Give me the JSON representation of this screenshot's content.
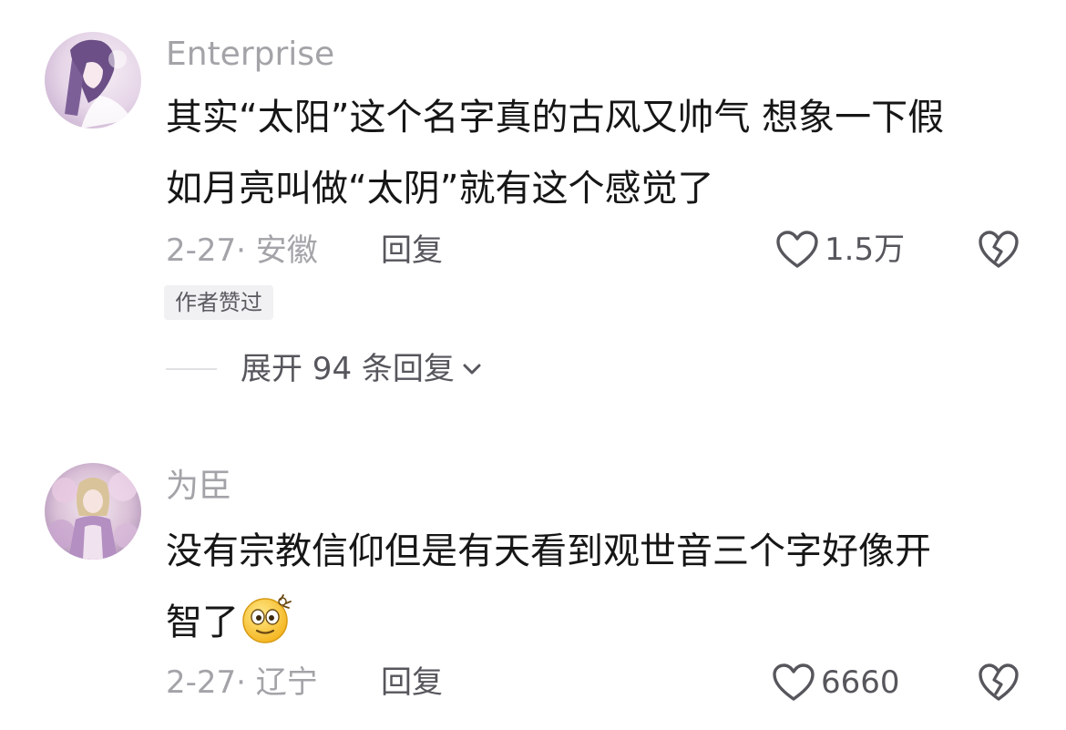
{
  "comments": [
    {
      "username": "Enterprise",
      "text": "其实“太阳”这个名字真的古风又帅气 想象一下假如月亮叫做“太阴”就有这个感觉了",
      "text_lines": [
        "其实“太阳”这个名字真的古风又帅气 想象一下假",
        "如月亮叫做“太阴”就有这个感觉了"
      ],
      "date_location": "2-27· 安徽",
      "reply_label": "回复",
      "like_count": "1.5万",
      "badge": "作者赞过",
      "expand_label": "展开 94 条回复",
      "avatar_icon": "avatar-anime-girl-icon",
      "like_icon": "heart-outline-icon",
      "dislike_icon": "broken-heart-icon"
    },
    {
      "username": "为臣",
      "text_lines": [
        "没有宗教信仰但是有天看到观世音三个字好像开",
        "智了"
      ],
      "emoji": "dizzy-face-emoji-icon",
      "date_location": "2-27· 辽宁",
      "reply_label": "回复",
      "like_count": "6660",
      "avatar_icon": "avatar-fantasy-character-icon",
      "like_icon": "heart-outline-icon",
      "dislike_icon": "broken-heart-icon"
    }
  ],
  "colors": {
    "primary_text": "#161616",
    "secondary_text": "#a3a3a8",
    "action_text": "#56565c",
    "badge_bg": "#f1f1f3"
  }
}
